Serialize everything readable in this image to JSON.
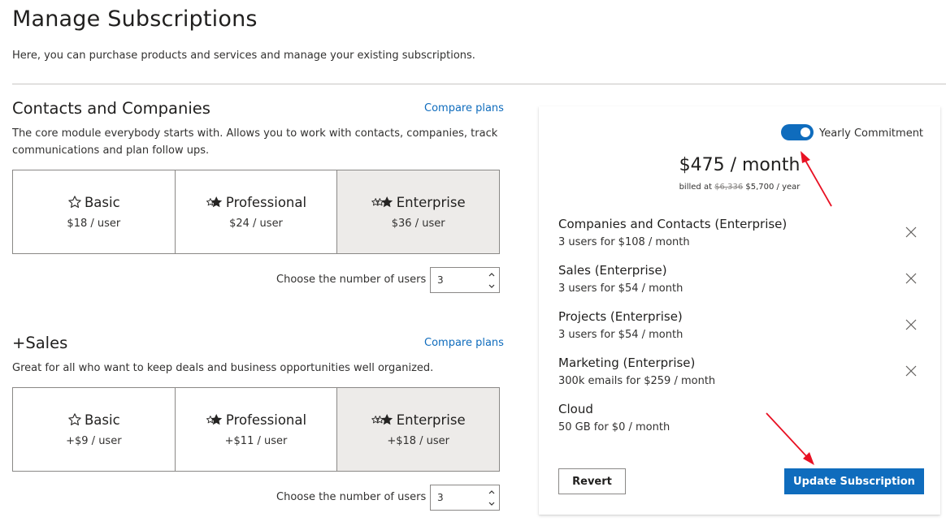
{
  "page": {
    "title": "Manage Subscriptions",
    "subtitle": "Here, you can purchase products and services and manage your existing subscriptions."
  },
  "sections": [
    {
      "title": "Contacts and Companies",
      "compare_label": "Compare plans",
      "description": "The core module everybody starts with. Allows you to work with contacts, companies, track communications and plan follow ups.",
      "tiers": [
        {
          "name": "Basic",
          "price": "$18 / user",
          "icon": "star-outline-icon",
          "selected": false
        },
        {
          "name": "Professional",
          "price": "$24 / user",
          "icon": "stars-two-icon",
          "selected": false
        },
        {
          "name": "Enterprise",
          "price": "$36 / user",
          "icon": "stars-three-icon",
          "selected": true
        }
      ],
      "users_label": "Choose the number of users",
      "users_value": "3"
    },
    {
      "title": "+Sales",
      "compare_label": "Compare plans",
      "description": "Great for all who want to keep deals and business opportunities well organized.",
      "tiers": [
        {
          "name": "Basic",
          "price": "+$9 / user",
          "icon": "star-outline-icon",
          "selected": false
        },
        {
          "name": "Professional",
          "price": "+$11 / user",
          "icon": "stars-two-icon",
          "selected": false
        },
        {
          "name": "Enterprise",
          "price": "+$18 / user",
          "icon": "stars-three-icon",
          "selected": true
        }
      ],
      "users_label": "Choose the number of users",
      "users_value": "3"
    }
  ],
  "summary": {
    "toggle_label": "Yearly Commitment",
    "toggle_on": true,
    "price": "$475 / month",
    "billed_prefix": "billed at",
    "billed_old": "$6,336",
    "billed_new": "$5,700 / year",
    "items": [
      {
        "title": "Companies and Contacts (Enterprise)",
        "detail": "3 users for $108 / month",
        "removable": true
      },
      {
        "title": "Sales (Enterprise)",
        "detail": "3 users for $54 / month",
        "removable": true
      },
      {
        "title": "Projects (Enterprise)",
        "detail": "3 users for $54 / month",
        "removable": true
      },
      {
        "title": "Marketing (Enterprise)",
        "detail": "300k emails for $259 / month",
        "removable": true
      },
      {
        "title": "Cloud",
        "detail": "50 GB for $0 / month",
        "removable": false
      }
    ],
    "revert_label": "Revert",
    "update_label": "Update Subscription"
  },
  "colors": {
    "accent": "#0f6cbd",
    "selected_tier_bg": "#edebe9",
    "annotation_arrow": "#e81123"
  }
}
